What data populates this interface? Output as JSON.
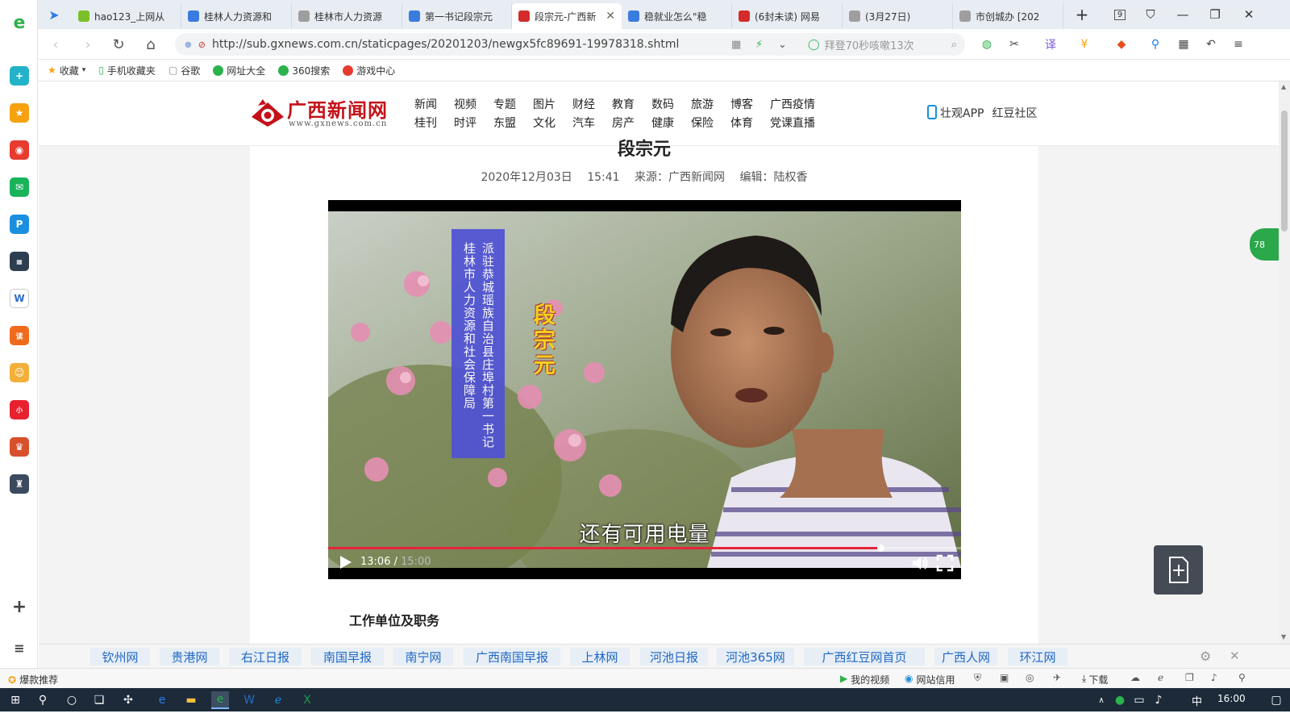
{
  "browser": {
    "tabs": [
      {
        "label": "hao123_上网从",
        "color": "#7bbf2a"
      },
      {
        "label": "桂林人力资源和",
        "color": "#3a7be0"
      },
      {
        "label": "桂林市人力资源",
        "color": "#9e9e9e"
      },
      {
        "label": "第一书记段宗元",
        "color": "#3a7be0"
      },
      {
        "label": "段宗元-广西新",
        "color": "#d42b2b",
        "active": true
      },
      {
        "label": "稳就业怎么\"稳",
        "color": "#3a7be0"
      },
      {
        "label": "(6封未读) 网易",
        "color": "#d42b2b"
      },
      {
        "label": "(3月27日)",
        "color": "#9e9e9e"
      },
      {
        "label": "市创城办 [202",
        "color": "#9e9e9e"
      }
    ],
    "tab_count": "9",
    "url": "http://sub.gxnews.com.cn/staticpages/20201203/newgx5fc89691-19978318.shtml",
    "search_placeholder": "拜登70秒咳嗽13次",
    "bookmarks": [
      "收藏",
      "手机收藏夹",
      "谷歌",
      "网址大全",
      "360搜索",
      "游戏中心"
    ]
  },
  "site": {
    "logo_title": "广西新闻网",
    "logo_url": "www.gxnews.com.cn",
    "nav": [
      "新闻",
      "视频",
      "专题",
      "图片",
      "财经",
      "教育",
      "数码",
      "旅游",
      "博客",
      "广西疫情",
      "桂刊",
      "时评",
      "东盟",
      "文化",
      "汽车",
      "房产",
      "健康",
      "保险",
      "体育",
      "党课直播"
    ],
    "app_link": "壮观APP",
    "community_link": "红豆社区"
  },
  "article": {
    "title_partial": "段宗元",
    "meta": "2020年12月03日 15:41   来源：广西新闻网   编辑：陆权香",
    "section_heading": "工作单位及职务"
  },
  "video": {
    "caption_col1": "派驻恭城瑶族自治县庄埠村第一书记",
    "caption_col2": "桂林市人力资源和社会保障局",
    "person_name": "段宗元",
    "subtitle": "还有可用电量",
    "time_current": "13:06 /",
    "time_total": " 15:00",
    "progress": 0.873
  },
  "partners": [
    "钦州网",
    "贵港网",
    "右江日报",
    "南国早报",
    "南宁网",
    "广西南国早报",
    "上林网",
    "河池日报",
    "河池365网",
    "广西红豆网首页",
    "广西人网",
    "环江网"
  ],
  "side_badge": "78",
  "statusbar": {
    "left": "爆款推荐",
    "my_video": "我的视频",
    "site_trust": "网站信用",
    "download": "下载"
  },
  "taskbar": {
    "ime": "中",
    "time": "16:00"
  }
}
